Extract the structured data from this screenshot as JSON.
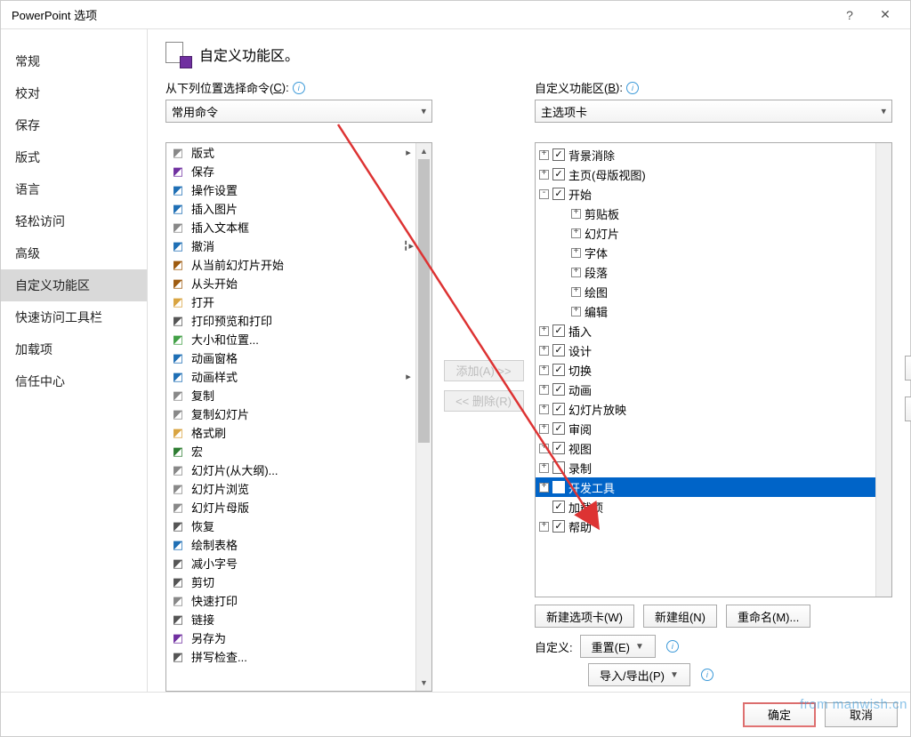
{
  "window": {
    "title": "PowerPoint 选项"
  },
  "sidebar": {
    "items": [
      {
        "label": "常规"
      },
      {
        "label": "校对"
      },
      {
        "label": "保存"
      },
      {
        "label": "版式"
      },
      {
        "label": "语言"
      },
      {
        "label": "轻松访问"
      },
      {
        "label": "高级"
      },
      {
        "label": "自定义功能区",
        "selected": true
      },
      {
        "label": "快速访问工具栏"
      },
      {
        "label": "加载项"
      },
      {
        "label": "信任中心"
      }
    ]
  },
  "main": {
    "header": "自定义功能区。",
    "choose_label_prefix": "从下列位置选择命令(",
    "choose_label_u": "C",
    "choose_label_suffix": "):",
    "choose_value": "常用命令",
    "ribbon_label_prefix": "自定义功能区(",
    "ribbon_label_u": "B",
    "ribbon_label_suffix": "):",
    "ribbon_value": "主选项卡",
    "add_btn": "添加(A) >>",
    "remove_btn": "<< 删除(R)",
    "new_tab_btn": "新建选项卡(W)",
    "new_group_btn": "新建组(N)",
    "rename_btn": "重命名(M)...",
    "customize_label": "自定义:",
    "reset_btn": "重置(E)",
    "import_btn": "导入/导出(P)"
  },
  "commands": [
    {
      "icon": "layout",
      "color": "#888",
      "label": "版式",
      "submenu": true
    },
    {
      "icon": "save",
      "color": "#7030a0",
      "label": "保存"
    },
    {
      "icon": "action",
      "color": "#1f6fb5",
      "label": "操作设置"
    },
    {
      "icon": "img",
      "color": "#1f6fb5",
      "label": "插入图片"
    },
    {
      "icon": "textbox",
      "color": "#888",
      "label": "插入文本框"
    },
    {
      "icon": "undo",
      "color": "#1f6fb5",
      "label": "撤消",
      "split": true
    },
    {
      "icon": "present",
      "color": "#9e5b0f",
      "label": "从当前幻灯片开始"
    },
    {
      "icon": "present2",
      "color": "#9e5b0f",
      "label": "从头开始"
    },
    {
      "icon": "open",
      "color": "#d9a441",
      "label": "打开"
    },
    {
      "icon": "preview",
      "color": "#555",
      "label": "打印预览和打印"
    },
    {
      "icon": "size",
      "color": "#43a047",
      "label": "大小和位置..."
    },
    {
      "icon": "animpane",
      "color": "#1f6fb5",
      "label": "动画窗格"
    },
    {
      "icon": "animstyle",
      "color": "#1f6fb5",
      "label": "动画样式",
      "submenu": true
    },
    {
      "icon": "copy",
      "color": "#888",
      "label": "复制"
    },
    {
      "icon": "copyslide",
      "color": "#888",
      "label": "复制幻灯片"
    },
    {
      "icon": "fmtpaint",
      "color": "#d9a441",
      "label": "格式刷"
    },
    {
      "icon": "macro",
      "color": "#2e7d32",
      "label": "宏"
    },
    {
      "icon": "outline",
      "color": "#888",
      "label": "幻灯片(从大纲)..."
    },
    {
      "icon": "sorter",
      "color": "#888",
      "label": "幻灯片浏览"
    },
    {
      "icon": "master",
      "color": "#888",
      "label": "幻灯片母版"
    },
    {
      "icon": "redo",
      "color": "#555",
      "label": "恢复"
    },
    {
      "icon": "table",
      "color": "#1f6fb5",
      "label": "绘制表格"
    },
    {
      "icon": "fontdec",
      "color": "#555",
      "label": "减小字号"
    },
    {
      "icon": "cut",
      "color": "#555",
      "label": "剪切"
    },
    {
      "icon": "quickprint",
      "color": "#888",
      "label": "快速打印"
    },
    {
      "icon": "link",
      "color": "#555",
      "label": "链接"
    },
    {
      "icon": "saveas",
      "color": "#7030a0",
      "label": "另存为"
    },
    {
      "icon": "spell",
      "color": "#555",
      "label": "拼写检查..."
    }
  ],
  "tree": [
    {
      "indent": 0,
      "exp": "+",
      "checked": true,
      "label": "背景消除"
    },
    {
      "indent": 0,
      "exp": "+",
      "checked": true,
      "label": "主页(母版视图)"
    },
    {
      "indent": 0,
      "exp": "-",
      "checked": true,
      "label": "开始"
    },
    {
      "indent": 1,
      "exp": "+",
      "label": "剪贴板"
    },
    {
      "indent": 1,
      "exp": "+",
      "label": "幻灯片"
    },
    {
      "indent": 1,
      "exp": "+",
      "label": "字体"
    },
    {
      "indent": 1,
      "exp": "+",
      "label": "段落"
    },
    {
      "indent": 1,
      "exp": "+",
      "label": "绘图"
    },
    {
      "indent": 1,
      "exp": "+",
      "label": "编辑"
    },
    {
      "indent": 0,
      "exp": "+",
      "checked": true,
      "label": "插入"
    },
    {
      "indent": 0,
      "exp": "+",
      "checked": true,
      "label": "设计"
    },
    {
      "indent": 0,
      "exp": "+",
      "checked": true,
      "label": "切换"
    },
    {
      "indent": 0,
      "exp": "+",
      "checked": true,
      "label": "动画"
    },
    {
      "indent": 0,
      "exp": "+",
      "checked": true,
      "label": "幻灯片放映"
    },
    {
      "indent": 0,
      "exp": "+",
      "checked": true,
      "label": "审阅"
    },
    {
      "indent": 0,
      "exp": "+",
      "checked": true,
      "label": "视图"
    },
    {
      "indent": 0,
      "exp": "+",
      "checked": false,
      "label": "录制"
    },
    {
      "indent": 0,
      "exp": "+",
      "checked": true,
      "label": "开发工具",
      "selected": true
    },
    {
      "indent": 0,
      "exp": "",
      "checked": true,
      "label": "加载项"
    },
    {
      "indent": 0,
      "exp": "+",
      "checked": true,
      "label": "帮助"
    }
  ],
  "footer": {
    "ok": "确定",
    "cancel": "取消"
  },
  "watermark": "from manwish.cn"
}
